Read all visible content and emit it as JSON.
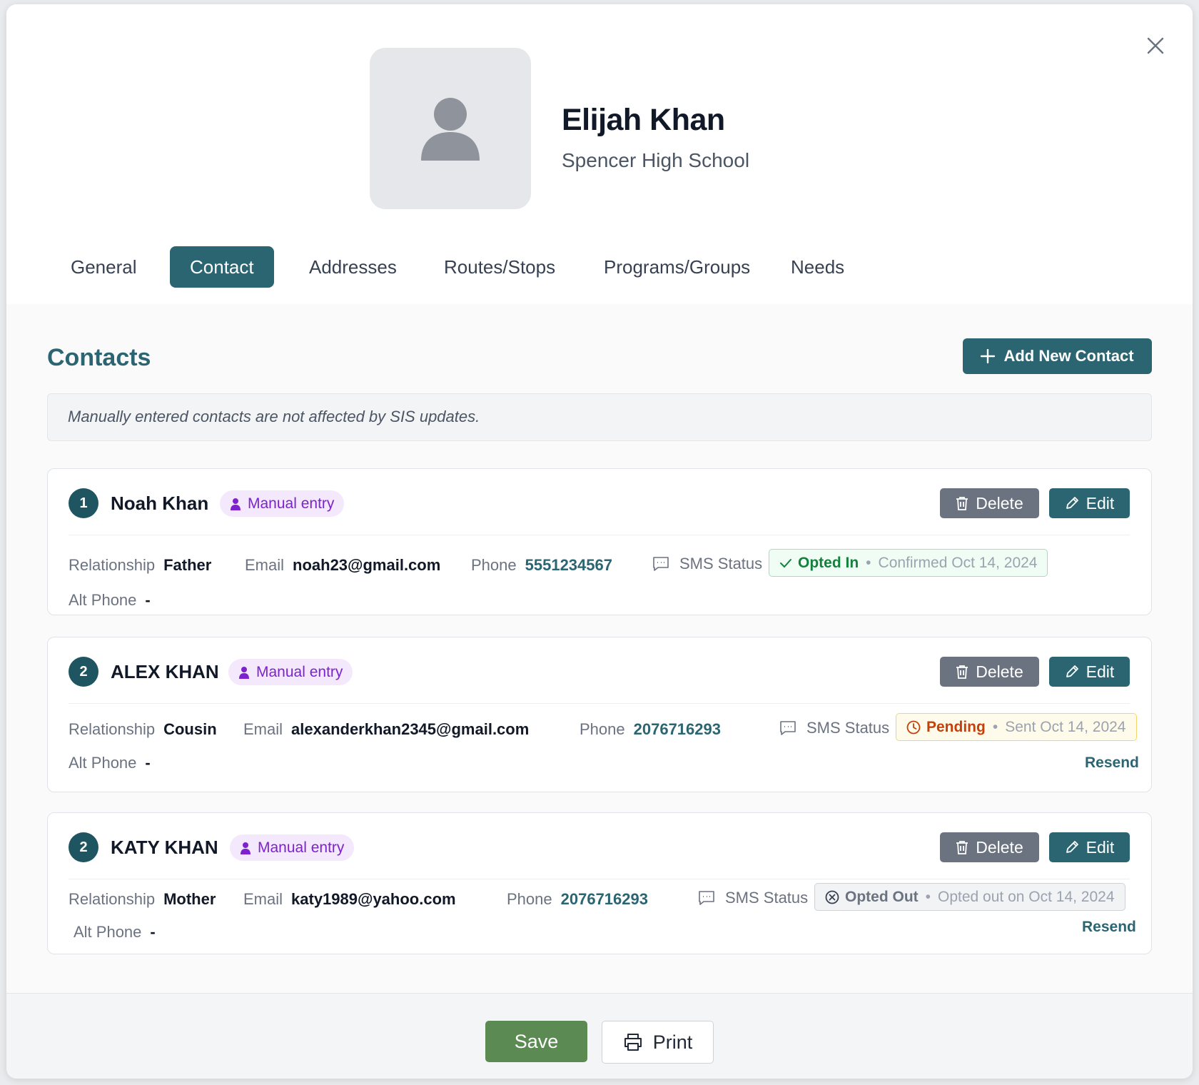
{
  "student": {
    "name": "Elijah Khan",
    "school": "Spencer High School"
  },
  "tabs": [
    "General",
    "Contact",
    "Addresses",
    "Routes/Stops",
    "Programs/Groups",
    "Needs"
  ],
  "active_tab": "Contact",
  "section": {
    "title": "Contacts",
    "add_button": "Add New Contact",
    "notice": "Manually entered contacts are not affected by SIS updates."
  },
  "labels": {
    "relationship": "Relationship",
    "email": "Email",
    "phone": "Phone",
    "sms_status": "SMS Status",
    "alt_phone": "Alt Phone",
    "delete": "Delete",
    "edit": "Edit",
    "resend": "Resend",
    "manual_entry": "Manual entry",
    "dot": "•"
  },
  "contacts": [
    {
      "number": "1",
      "name": "Noah Khan",
      "relationship": "Father",
      "email": "noah23@gmail.com",
      "phone": "5551234567",
      "alt_phone": "-",
      "sms_status": "Opted In",
      "sms_meta": "Confirmed Oct 14, 2024"
    },
    {
      "number": "2",
      "name": "ALEX KHAN",
      "relationship": "Cousin",
      "email": "alexanderkhan2345@gmail.com",
      "phone": "2076716293",
      "alt_phone": "-",
      "sms_status": "Pending",
      "sms_meta": "Sent Oct 14, 2024"
    },
    {
      "number": "2",
      "name": "KATY KHAN",
      "relationship": "Mother",
      "email": "katy1989@yahoo.com",
      "phone": "2076716293",
      "alt_phone": "-",
      "sms_status": "Opted Out",
      "sms_meta": "Opted out on Oct 14, 2024"
    }
  ],
  "footer": {
    "save": "Save",
    "print": "Print"
  },
  "colors": {
    "primary": "#2b6572",
    "save_green": "#5b8a53",
    "manual_badge": "#7e22ce",
    "opted_in": "#15803d",
    "pending": "#c2410c"
  }
}
